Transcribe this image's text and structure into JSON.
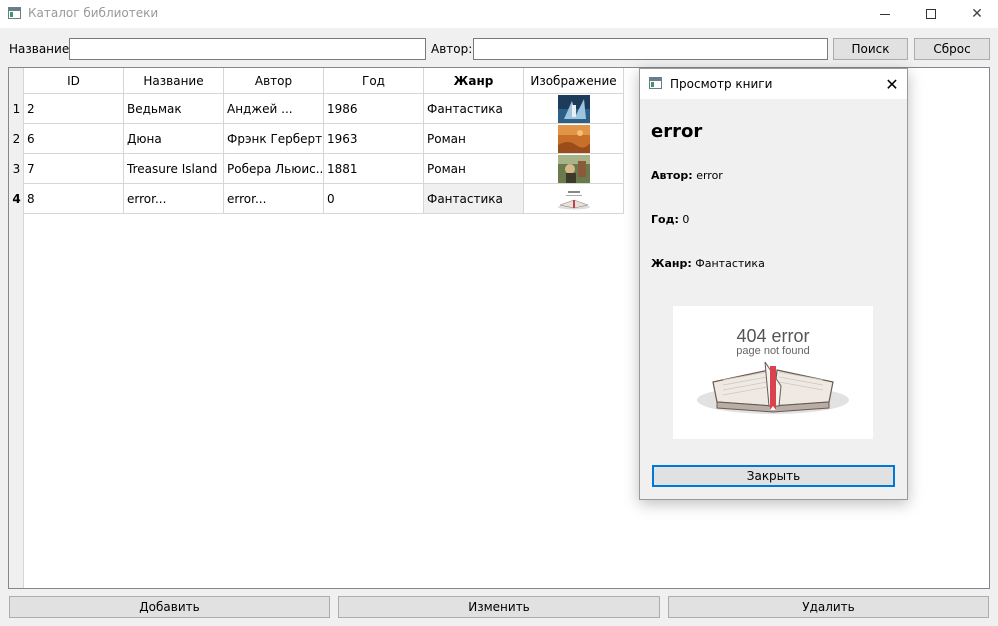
{
  "window": {
    "title": "Каталог библиотеки",
    "minimize": "minimize",
    "maximize": "maximize",
    "close": "✕"
  },
  "filters": {
    "name_label": "Название:",
    "name_value": "",
    "author_label": "Автор:",
    "author_value": "",
    "search_button": "Поиск",
    "reset_button": "Сброс"
  },
  "table": {
    "columns": [
      "ID",
      "Название",
      "Автор",
      "Год",
      "Жанр",
      "Изображение"
    ],
    "rows": [
      {
        "num": "1",
        "id": "2",
        "name": "Ведьмак",
        "author": "Анджей ...",
        "year": "1986",
        "genre": "Фантастика",
        "image": "witcher-cover"
      },
      {
        "num": "2",
        "id": "6",
        "name": "Дюна",
        "author": "Фрэнк Герберт",
        "year": "1963",
        "genre": "Роман",
        "image": "dune-cover"
      },
      {
        "num": "3",
        "id": "7",
        "name": "Treasure Island",
        "author": " Робера Льюис...",
        "year": "1881",
        "genre": "Роман",
        "image": "treasure-island-cover"
      },
      {
        "num": "4",
        "id": "8",
        "name": "error...",
        "author": "error...",
        "year": "0",
        "genre": "Фантастика",
        "image": "404-error-thumb"
      }
    ]
  },
  "actions": {
    "add": "Добавить",
    "edit": "Изменить",
    "delete": "Удалить"
  },
  "dialog": {
    "title": "Просмотр книги",
    "close_x": "✕",
    "heading": "error",
    "author_label": "Автор:",
    "author_value": "error",
    "year_label": "Год:",
    "year_value": "0",
    "genre_label": "Жанр:",
    "genre_value": "Фантастика",
    "image_title": "404 error",
    "image_subtitle": "page not found",
    "close_button": "Закрыть"
  },
  "colors": {
    "accent": "#0078d7",
    "button_bg": "#e1e1e1",
    "window_bg": "#f0f0f0"
  }
}
